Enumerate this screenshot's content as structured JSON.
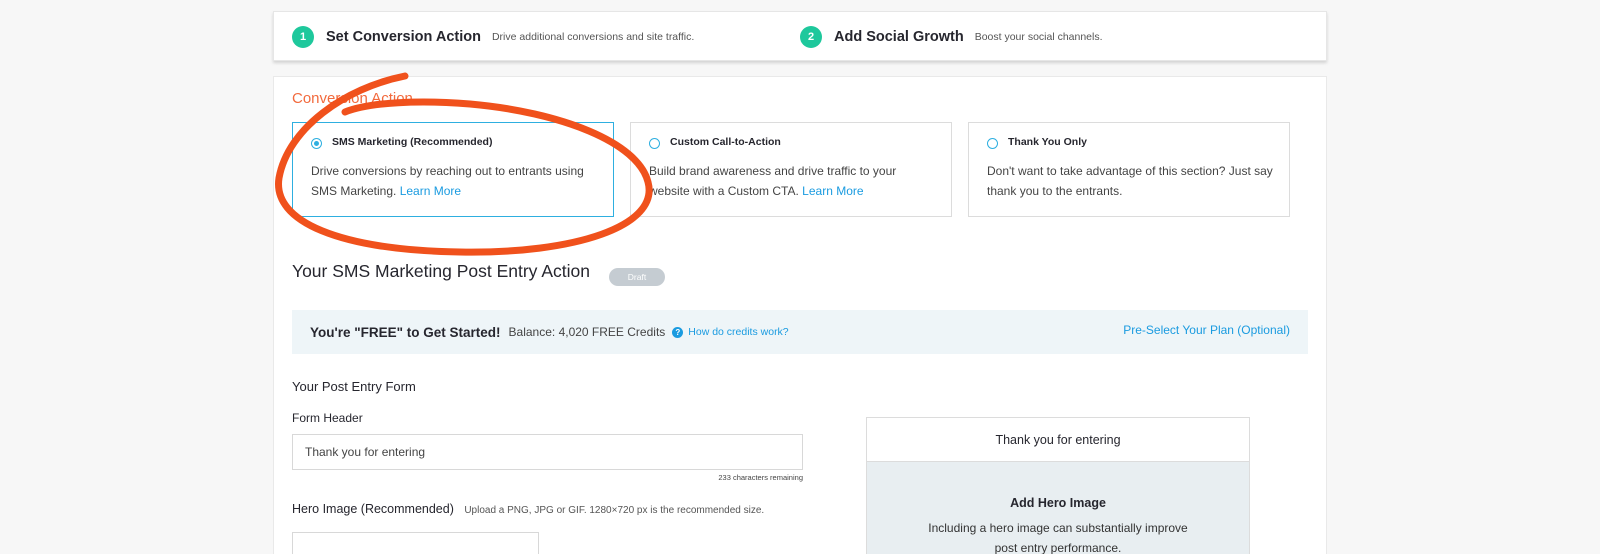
{
  "steps": [
    {
      "number": "1",
      "title": "Set Conversion Action",
      "description": "Drive additional conversions and site traffic."
    },
    {
      "number": "2",
      "title": "Add Social Growth",
      "description": "Boost your social channels."
    }
  ],
  "conversion": {
    "section_title": "Conversion Action",
    "options": [
      {
        "title": "SMS Marketing (Recommended)",
        "description": "Drive conversions by reaching out to entrants using SMS Marketing.",
        "link": "Learn More",
        "selected": true
      },
      {
        "title": "Custom Call-to-Action",
        "description": "Build brand awareness and drive traffic to your website with a Custom CTA.",
        "link": "Learn More",
        "selected": false
      },
      {
        "title": "Thank You Only",
        "description": "Don't want to take advantage of this section? Just say thank you to the entrants.",
        "selected": false
      }
    ]
  },
  "sms": {
    "heading": "Your SMS Marketing Post Entry Action",
    "badge": "Draft"
  },
  "credits": {
    "title": "You're \"FREE\" to Get Started!",
    "balance": "Balance: 4,020 FREE Credits",
    "help_icon": "?",
    "help_link": "How do credits work?",
    "preselect": "Pre-Select Your Plan (Optional)"
  },
  "form": {
    "title": "Your Post Entry Form",
    "header_label": "Form Header",
    "header_value": "Thank you for entering",
    "chars_remaining": "233 characters remaining",
    "hero_label": "Hero Image (Recommended)",
    "hero_hint": "Upload a PNG, JPG or GIF. 1280×720 px is the recommended size."
  },
  "preview": {
    "header": "Thank you for entering",
    "hero_title": "Add Hero Image",
    "hero_description": "Including a hero image can substantially improve post entry performance."
  },
  "colors": {
    "accent": "#1a9be0",
    "step_badge": "#1ec89c",
    "section_title": "#f26a3d",
    "annotation": "#f0511c"
  }
}
